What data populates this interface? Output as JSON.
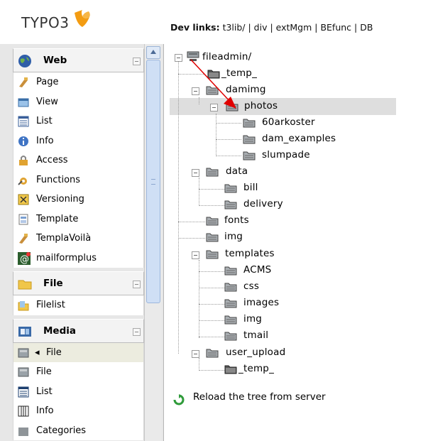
{
  "header": {
    "logo_text": "TYPO3",
    "devlinks_label": "Dev links:",
    "devlinks_items": "t3lib/ | div | extMgm | BEfunc | DB"
  },
  "menu": {
    "web": {
      "title": "Web",
      "items": [
        "Page",
        "View",
        "List",
        "Info",
        "Access",
        "Functions",
        "Versioning",
        "Template",
        "TemplaVoilà",
        "mailformplus"
      ]
    },
    "file": {
      "title": "File",
      "items": [
        "Filelist"
      ]
    },
    "media": {
      "title": "Media",
      "items": [
        "File",
        "File",
        "List",
        "Info",
        "Categories"
      ]
    }
  },
  "tree": {
    "root": "fileadmin/",
    "nodes": [
      "_temp_",
      "damimg",
      "photos",
      "60arkoster",
      "dam_examples",
      "slumpade",
      "data",
      "bill",
      "delivery",
      "fonts",
      "img",
      "templates",
      "ACMS",
      "css",
      "images",
      "img",
      "tmail",
      "user_upload",
      "_temp_"
    ],
    "selected": "photos",
    "reload_label": "Reload the tree from server"
  },
  "colors": {
    "accent_orange": "#f39c12",
    "selection_gray": "#dedede",
    "arrow_red": "#e00000"
  }
}
